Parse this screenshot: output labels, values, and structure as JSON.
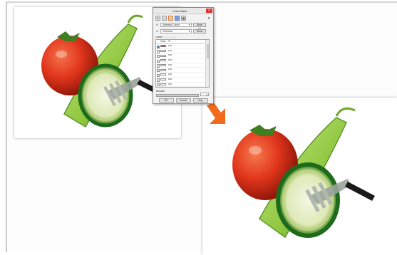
{
  "dialog": {
    "title": "Color Mask",
    "close_glyph": "×",
    "toolbar": {
      "icons": [
        "eyedropper-icon",
        "add-icon",
        "subtract-icon",
        "color-swatch-icon",
        "grid-icon"
      ],
      "glyphs": [
        "✎",
        "+",
        "−",
        "▪",
        "▦"
      ]
    },
    "select_row": {
      "icon_glyph": "✐",
      "select_value": "Selected Colors",
      "button_label": "More >>"
    },
    "mode_row": {
      "icon_glyph": "⚠",
      "select_value": "Overview",
      "button_label": "Reset"
    },
    "levels": {
      "label": "Levels",
      "dots": "• • • • •"
    },
    "table": {
      "headers": [
        "",
        "Color",
        "%"
      ],
      "rows": [
        {
          "checked": true,
          "color": "#d92b1a",
          "value": "100"
        },
        {
          "checked": false,
          "color": "#ffffff",
          "value": "100"
        },
        {
          "checked": false,
          "color": "#ffffff",
          "value": "100"
        },
        {
          "checked": false,
          "color": "#ffffff",
          "value": "100"
        },
        {
          "checked": false,
          "color": "#ffffff",
          "value": "100"
        },
        {
          "checked": false,
          "color": "#ffffff",
          "value": "100"
        },
        {
          "checked": false,
          "color": "#ffffff",
          "value": "100"
        },
        {
          "checked": false,
          "color": "#ffffff",
          "value": "100"
        },
        {
          "checked": false,
          "color": "#ffffff",
          "value": "100"
        },
        {
          "checked": false,
          "color": "#ffffff",
          "value": "100"
        }
      ]
    },
    "smooth": {
      "label": "Smooth",
      "value": "0"
    },
    "buttons": {
      "ok": "OK",
      "cancel": "Cancel",
      "help": "Help"
    }
  },
  "colors": {
    "arrow": "#f26b1d",
    "tomato": "#e2361c",
    "pepper": "#8dc63f",
    "cucumber_rind": "#1e6b1e",
    "close_button": "#d9352b"
  }
}
